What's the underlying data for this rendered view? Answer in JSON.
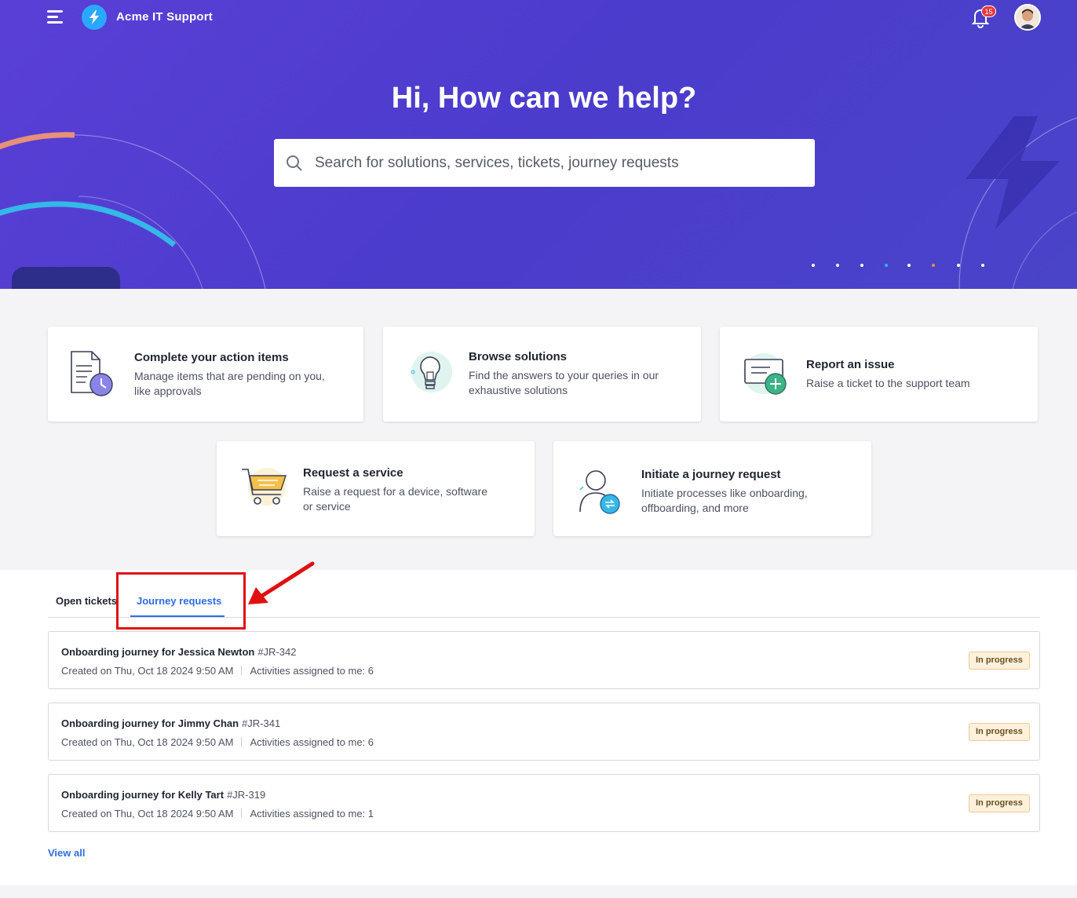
{
  "header": {
    "app_title": "Acme IT Support",
    "notification_count": "15"
  },
  "hero": {
    "title": "Hi, How can we help?",
    "search_placeholder": "Search for solutions, services, tickets, journey requests",
    "carousel_dot_colors": [
      "#ffffff",
      "#ffffff",
      "#ffffff",
      "#2bb6f0",
      "#ffffff",
      "#f08a4b",
      "#ffffff",
      "#ffffff"
    ]
  },
  "cards": [
    {
      "title": "Complete your action items",
      "desc": "Manage items that are pending on you, like approvals",
      "icon": "action-items-icon"
    },
    {
      "title": "Browse solutions",
      "desc": "Find the answers to your queries in our exhaustive solutions",
      "icon": "lightbulb-icon"
    },
    {
      "title": "Report an issue",
      "desc": "Raise a ticket to the support team",
      "icon": "report-issue-icon"
    },
    {
      "title": "Request a service",
      "desc": "Raise a request for a device, software or service",
      "icon": "shopping-cart-icon"
    },
    {
      "title": "Initiate a journey request",
      "desc": "Initiate processes like onboarding, offboarding, and more",
      "icon": "journey-user-icon"
    }
  ],
  "tabs": {
    "open_tickets": "Open tickets",
    "journey_requests": "Journey requests",
    "active": "journey_requests"
  },
  "requests": [
    {
      "title": "Onboarding journey for Jessica Newton",
      "id": "#JR-342",
      "created_label": "Created on",
      "created": "Thu, Oct 18 2024 9:50 AM",
      "activities_label": "Activities assigned to me:",
      "activities": "6",
      "status": "In progress"
    },
    {
      "title": "Onboarding journey for Jimmy Chan",
      "id": "#JR-341",
      "created_label": "Created on",
      "created": "Thu, Oct 18 2024 9:50 AM",
      "activities_label": "Activities assigned to me:",
      "activities": "6",
      "status": "In progress"
    },
    {
      "title": "Onboarding journey for Kelly Tart",
      "id": "#JR-319",
      "created_label": "Created on",
      "created": "Thu, Oct 18 2024 9:50 AM",
      "activities_label": "Activities assigned to me:",
      "activities": "1",
      "status": "In progress"
    }
  ],
  "view_all": "View all",
  "colors": {
    "hero_bg": "#4b3ccc",
    "accent": "#2f6de1",
    "highlight": "#e01010",
    "status_bg": "#fdf0dc"
  }
}
